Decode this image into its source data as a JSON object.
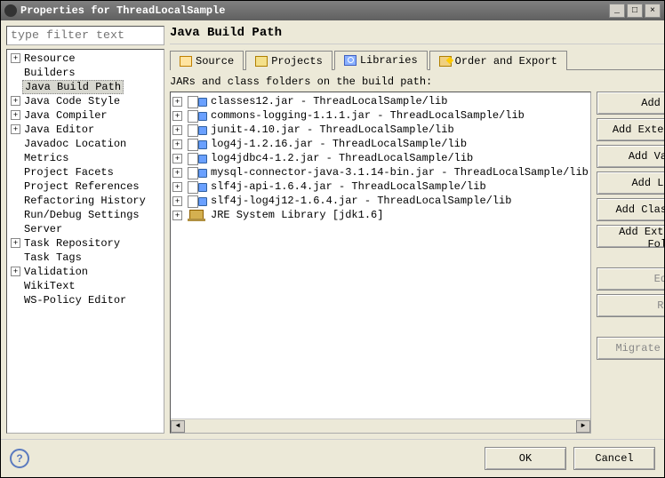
{
  "title": "Properties for ThreadLocalSample",
  "filter_placeholder": "type filter text",
  "tree": [
    {
      "label": "Resource",
      "expand": true
    },
    {
      "label": "Builders"
    },
    {
      "label": "Java Build Path",
      "selected": true
    },
    {
      "label": "Java Code Style",
      "expand": true
    },
    {
      "label": "Java Compiler",
      "expand": true
    },
    {
      "label": "Java Editor",
      "expand": true
    },
    {
      "label": "Javadoc Location"
    },
    {
      "label": "Metrics"
    },
    {
      "label": "Project Facets"
    },
    {
      "label": "Project References"
    },
    {
      "label": "Refactoring History"
    },
    {
      "label": "Run/Debug Settings"
    },
    {
      "label": "Server"
    },
    {
      "label": "Task Repository",
      "expand": true
    },
    {
      "label": "Task Tags"
    },
    {
      "label": "Validation",
      "expand": true
    },
    {
      "label": "WikiText"
    },
    {
      "label": "WS-Policy Editor"
    }
  ],
  "page_title": "Java Build Path",
  "tabs": [
    {
      "label": "Source",
      "icon": "source"
    },
    {
      "label": "Projects",
      "icon": "projects"
    },
    {
      "label": "Libraries",
      "icon": "libraries",
      "active": true
    },
    {
      "label": "Order and Export",
      "icon": "order"
    }
  ],
  "desc": "JARs and class folders on the build path:",
  "jars": [
    {
      "label": "classes12.jar - ThreadLocalSample/lib"
    },
    {
      "label": "commons-logging-1.1.1.jar - ThreadLocalSample/lib"
    },
    {
      "label": "junit-4.10.jar - ThreadLocalSample/lib"
    },
    {
      "label": "log4j-1.2.16.jar - ThreadLocalSample/lib"
    },
    {
      "label": "log4jdbc4-1.2.jar - ThreadLocalSample/lib"
    },
    {
      "label": "mysql-connector-java-3.1.14-bin.jar - ThreadLocalSample/lib"
    },
    {
      "label": "slf4j-api-1.6.4.jar - ThreadLocalSample/lib"
    },
    {
      "label": "slf4j-log4j12-1.6.4.jar - ThreadLocalSample/lib"
    },
    {
      "label": "JRE System Library [jdk1.6]",
      "jre": true
    }
  ],
  "buttons": {
    "add_jars": "Add JARs...",
    "add_ext_jars": "Add External JARs...",
    "add_var": "Add Variable...",
    "add_lib": "Add Library...",
    "add_class": "Add Class Folder...",
    "add_ext_class": "Add External Class Folder...",
    "edit": "Edit...",
    "remove": "Remove",
    "migrate": "Migrate JAR File..."
  },
  "footer": {
    "ok": "OK",
    "cancel": "Cancel"
  }
}
